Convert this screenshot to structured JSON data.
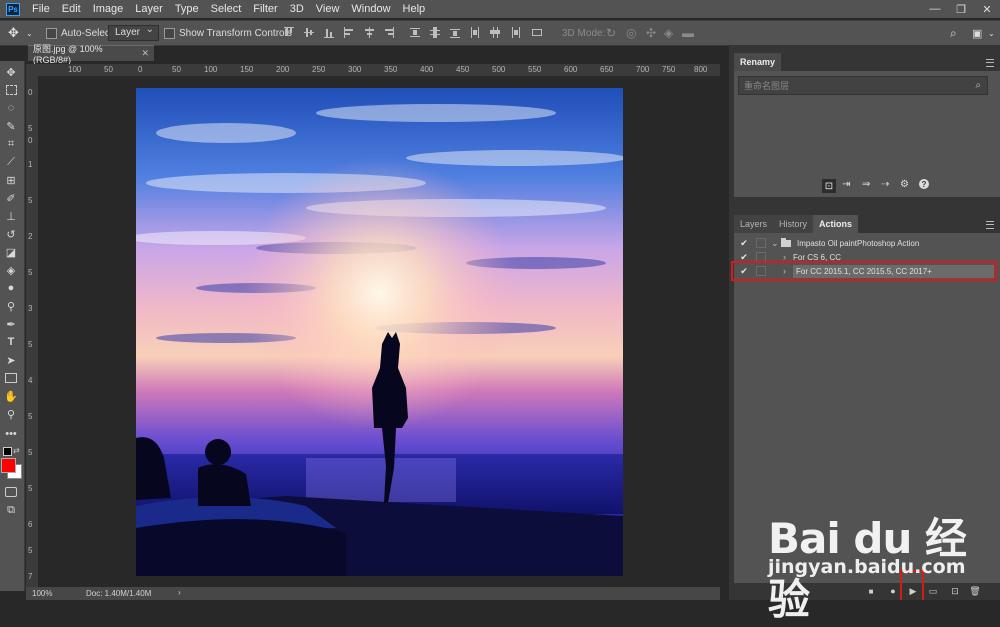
{
  "app": {
    "logo": "Ps"
  },
  "menu": [
    "File",
    "Edit",
    "Image",
    "Layer",
    "Type",
    "Select",
    "Filter",
    "3D",
    "View",
    "Window",
    "Help"
  ],
  "options_bar": {
    "auto_select_label": "Auto-Select:",
    "auto_select_value": "Layer",
    "show_transform_label": "Show Transform Controls",
    "mode_3d_label": "3D Mode:"
  },
  "document": {
    "tab_title": "原图.jpg @ 100% (RGB/8#)",
    "zoom": "100%",
    "doc_size": "Doc: 1.40M/1.40M"
  },
  "rulers": {
    "h_ticks": [
      "100",
      "50",
      "0",
      "50",
      "100",
      "150",
      "200",
      "250",
      "300",
      "350",
      "400",
      "450",
      "500",
      "550",
      "600",
      "650",
      "700",
      "750",
      "800"
    ],
    "v_ticks": [
      "0",
      "5",
      "0",
      "1",
      "5",
      "2",
      "5",
      "3",
      "5",
      "4",
      "5",
      "5",
      "5",
      "6",
      "5",
      "7"
    ]
  },
  "renamy_panel": {
    "title": "Renamy",
    "search_placeholder": "重命名图层"
  },
  "actions_panel": {
    "tabs": [
      "Layers",
      "History",
      "Actions"
    ],
    "active_tab": "Actions",
    "rows": [
      {
        "checked": true,
        "expanded": true,
        "is_set": true,
        "label": "Impasto Oil paintPhotoshop Action"
      },
      {
        "checked": true,
        "expanded": false,
        "is_set": false,
        "label": "For CS 6, CC"
      },
      {
        "checked": true,
        "expanded": false,
        "is_set": false,
        "label": "For CC 2015.1, CC 2015.5, CC 2017+",
        "selected": true
      }
    ]
  },
  "watermark": {
    "brand": "Bai du 经验",
    "url": "jingyan.baidu.com"
  },
  "colors": {
    "accent_red": "#d71a1a",
    "foreground_swatch": "#ff0000",
    "background_swatch": "#ffffff",
    "ps_blue": "#31a8ff"
  }
}
